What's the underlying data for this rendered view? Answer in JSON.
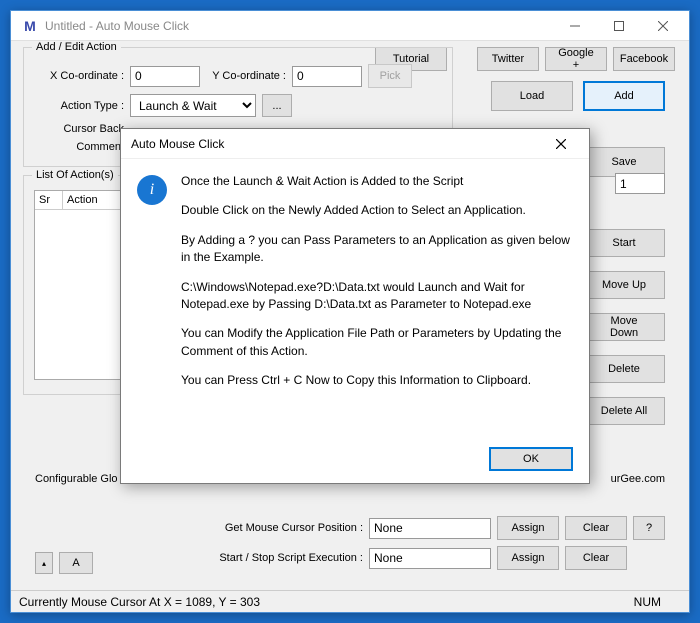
{
  "window": {
    "title": "Untitled - Auto Mouse Click"
  },
  "topbar": {
    "tutorial": "Tutorial",
    "twitter": "Twitter",
    "google": "Google +",
    "facebook": "Facebook"
  },
  "edit_group": {
    "title": "Add / Edit Action",
    "x_label": "X Co-ordinate :",
    "x_value": "0",
    "y_label": "Y Co-ordinate :",
    "y_value": "0",
    "pick": "Pick",
    "action_type_label": "Action Type :",
    "action_type_value": "Launch & Wait",
    "ellipsis": "...",
    "cursor_back_label": "Cursor Back",
    "comment_label": "Comment"
  },
  "right": {
    "add": "Add",
    "load": "Load",
    "save": "Save",
    "count_value": "1",
    "start": "Start",
    "moveup": "Move Up",
    "movedown": "Move Down",
    "delete": "Delete",
    "deleteall": "Delete All"
  },
  "list_group": {
    "title": "List Of Action(s)",
    "col_sr": "Sr",
    "col_action": "Action"
  },
  "cfg": {
    "label": "Configurable Glo",
    "link_suffix": "urGee.com"
  },
  "bottom": {
    "get_cursor_label": "Get Mouse Cursor Position :",
    "get_cursor_value": "None",
    "startstop_label": "Start / Stop Script Execution :",
    "startstop_value": "None",
    "assign": "Assign",
    "clear": "Clear",
    "help": "?",
    "letter": "A"
  },
  "status": {
    "text": "Currently Mouse Cursor At X = 1089, Y = 303",
    "num": "NUM"
  },
  "modal": {
    "title": "Auto Mouse Click",
    "p1": "Once the Launch & Wait Action is Added to the Script",
    "p2": "Double Click on the Newly Added Action to Select an Application.",
    "p3": "By Adding a ? you can Pass Parameters to an Application as given below in the Example.",
    "p4": "C:\\Windows\\Notepad.exe?D:\\Data.txt would Launch and Wait for Notepad.exe by Passing D:\\Data.txt as Parameter to Notepad.exe",
    "p5": "You can Modify the Application File Path or Parameters by Updating the Comment of this Action.",
    "p6": "You can Press Ctrl + C Now to Copy this Information to Clipboard.",
    "ok": "OK"
  }
}
